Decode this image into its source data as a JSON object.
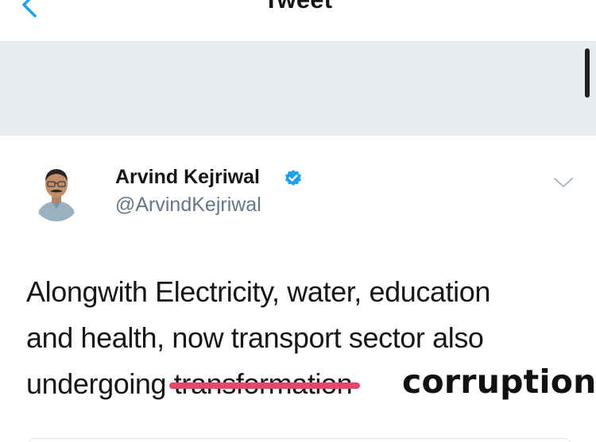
{
  "nav": {
    "title": "Tweet",
    "back_icon": "chevron-left-icon"
  },
  "tweet": {
    "author_name": "Arvind Kejriwal",
    "author_handle": "@ArvindKejriwal",
    "verified_icon": "verified-badge-icon",
    "menu_icon": "chevron-down-icon",
    "text_line1": "Alongwith Electricity, water, education",
    "text_line2": "and health, now transport sector also",
    "text_line3_prefix": "undergoing ",
    "struck_word": "transformation",
    "replacement_word": "corruption"
  },
  "colors": {
    "accent": "#1da1f2",
    "strike": "#e8456b",
    "band": "#e6ecf0"
  }
}
